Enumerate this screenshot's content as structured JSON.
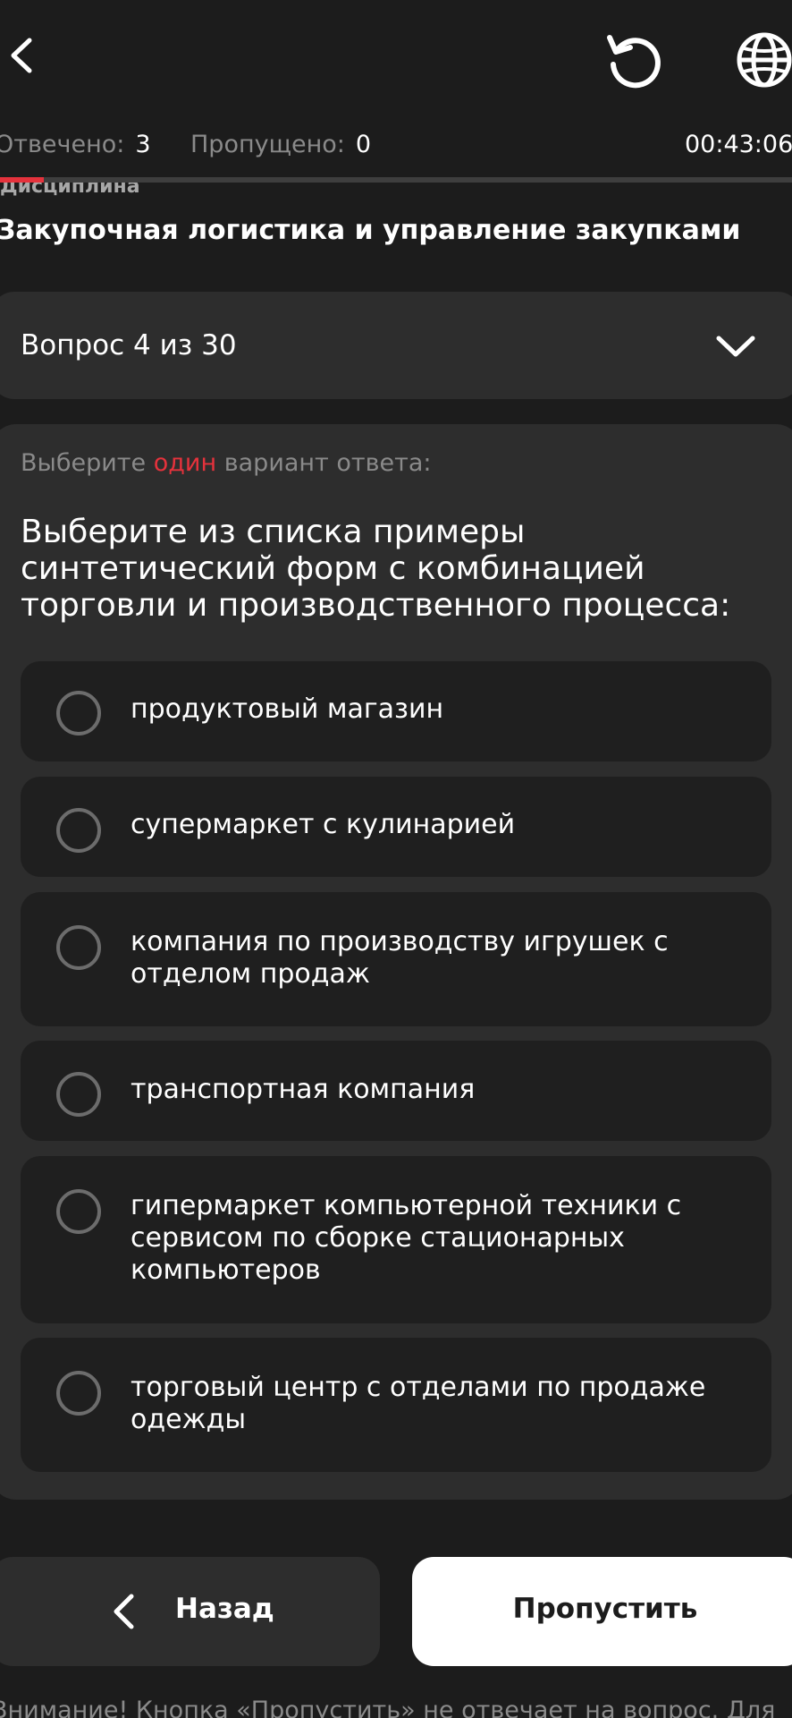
{
  "header": {
    "back_icon": "chevron-left-icon",
    "reset_icon": "refresh-icon",
    "language_icon": "globe-icon"
  },
  "stats": {
    "answered_label": "Отвечено:",
    "answered_value": "3",
    "skipped_label": "Пропущено:",
    "skipped_value": "0",
    "timer": "00:43:06"
  },
  "progress": {
    "fraction": 0.055,
    "fill_color": "#e5323c"
  },
  "discipline": {
    "label": "Дисциплина",
    "title": "Закупочная логистика и управление закупками"
  },
  "question_selector": {
    "label": "Вопрос 4 из 30",
    "icon": "chevron-down-icon"
  },
  "question": {
    "instruction_prefix": "Выберите",
    "instruction_accent": "один",
    "instruction_suffix": "вариант ответа:",
    "text": "Выберите из списка примеры синтетический форм с комбинацией торговли и производственного процесса:",
    "options": [
      {
        "label": "продуктовый магазин"
      },
      {
        "label": "супермаркет с кулинарией"
      },
      {
        "label": "компания по производству игрушек с отделом продаж"
      },
      {
        "label": "транспортная компания"
      },
      {
        "label": "гипермаркет компьютерной техники с сервисом по сборке стационарных компьютеров"
      },
      {
        "label": "торговый центр с отделами по продаже одежды"
      }
    ]
  },
  "buttons": {
    "back_label": "Назад",
    "skip_label": "Пропустить"
  },
  "footer": {
    "note": "Внимание! Кнопка «Пропустить» не отвечает на вопрос. Для"
  },
  "colors": {
    "background": "#1c1c1c",
    "card": "#2d2d2d",
    "option": "#1f1f1f",
    "accent": "#e5323c"
  }
}
